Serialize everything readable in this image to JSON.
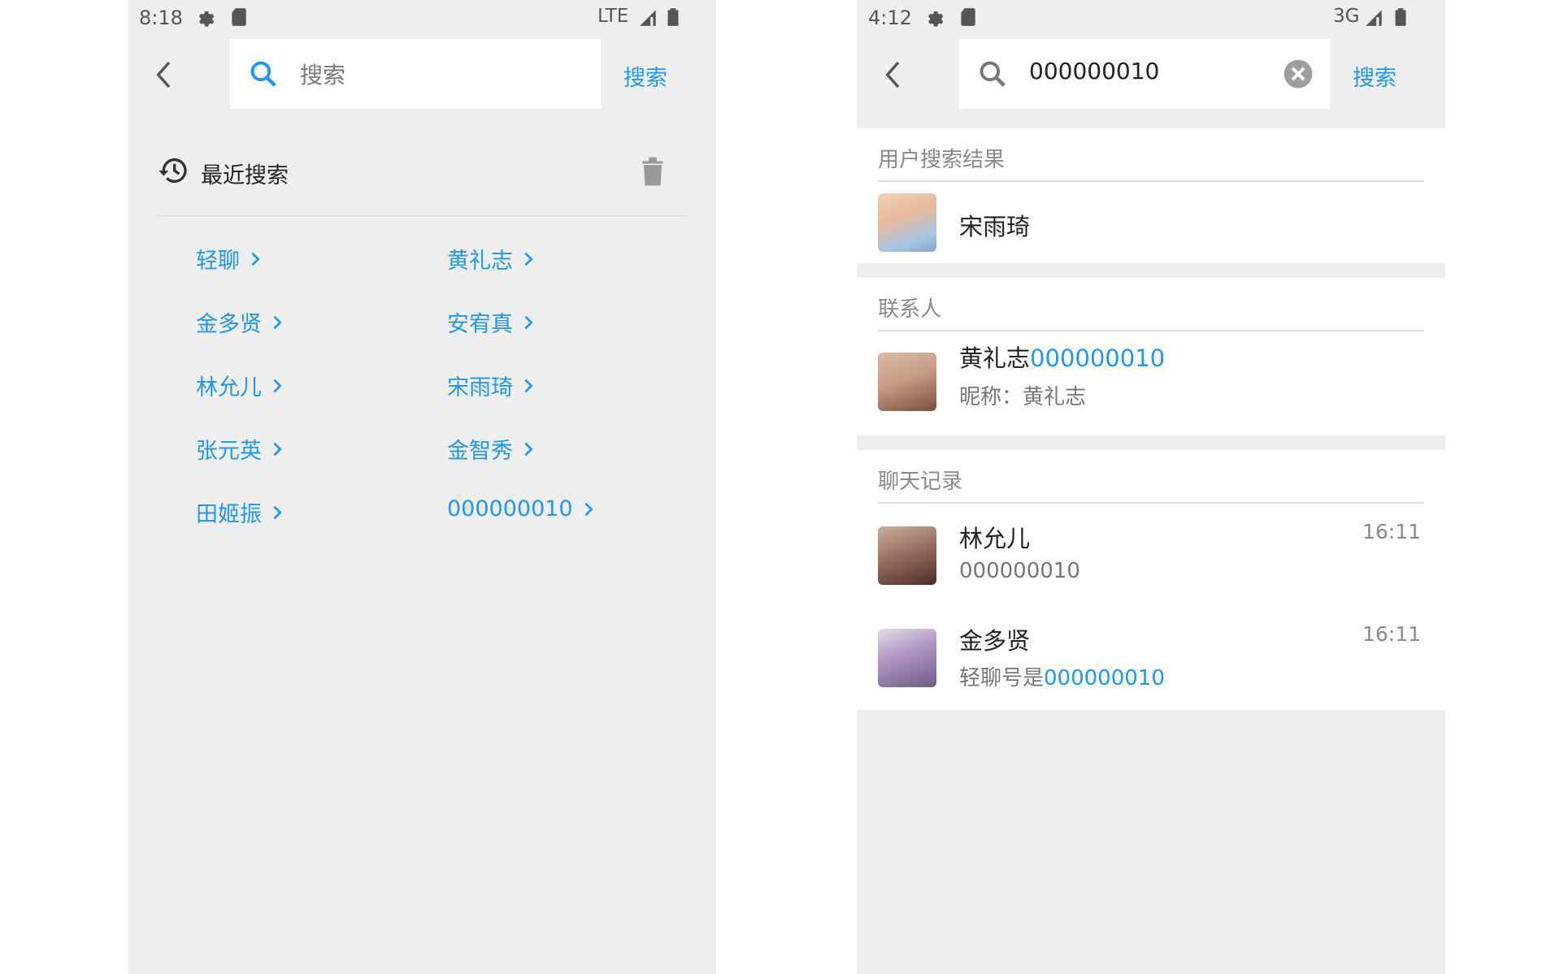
{
  "left": {
    "status": {
      "time": "8:18",
      "network": "LTE"
    },
    "search": {
      "placeholder": "搜索",
      "action_label": "搜索"
    },
    "recent": {
      "title": "最近搜索",
      "items": [
        "轻聊",
        "黄礼志",
        "金多贤",
        "安宥真",
        "林允儿",
        "宋雨琦",
        "张元英",
        "金智秀",
        "田姬振",
        "000000010"
      ]
    }
  },
  "right": {
    "status": {
      "time": "4:12",
      "network": "3G"
    },
    "search": {
      "value": "000000010",
      "action_label": "搜索"
    },
    "users_section": {
      "title": "用户搜索结果",
      "items": [
        {
          "name": "宋雨琦"
        }
      ]
    },
    "contacts_section": {
      "title": "联系人",
      "items": [
        {
          "name": "黄礼志",
          "match": "000000010",
          "nickname_label": "昵称：",
          "nickname": "黄礼志"
        }
      ]
    },
    "chats_section": {
      "title": "聊天记录",
      "items": [
        {
          "name": "林允儿",
          "time": "16:11",
          "prefix": "",
          "match": "000000010"
        },
        {
          "name": "金多贤",
          "time": "16:11",
          "prefix": "轻聊号是",
          "match": "000000010"
        }
      ]
    }
  },
  "colors": {
    "accent": "#2196f3",
    "background": "#eeeeee",
    "panel": "#ffffff"
  }
}
